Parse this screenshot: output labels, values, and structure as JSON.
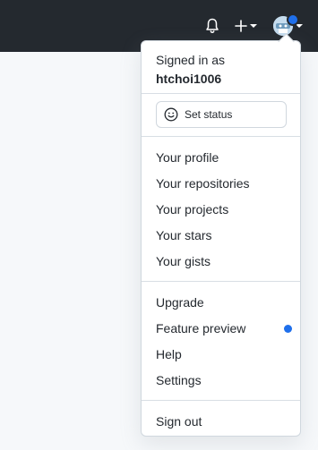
{
  "header": {
    "notifications_icon": "bell-icon",
    "create_icon": "plus-icon",
    "avatar_icon": "avatar-icon",
    "accent_color": "#1f6feb"
  },
  "menu": {
    "signed_in_label": "Signed in as",
    "username": "htchoi1006",
    "set_status_label": "Set status",
    "profile_items": [
      "Your profile",
      "Your repositories",
      "Your projects",
      "Your stars",
      "Your gists"
    ],
    "settings_items": [
      "Upgrade",
      "Feature preview",
      "Help",
      "Settings"
    ],
    "sign_out_label": "Sign out"
  }
}
